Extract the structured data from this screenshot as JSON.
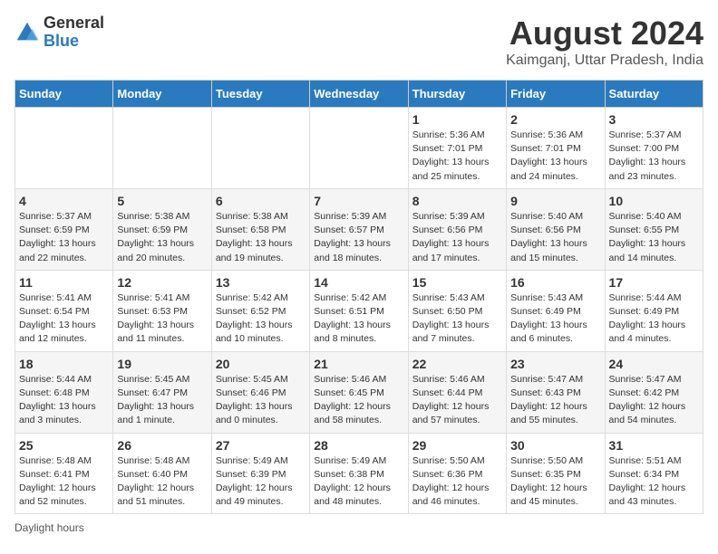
{
  "logo": {
    "general": "General",
    "blue": "Blue"
  },
  "title": "August 2024",
  "location": "Kaimganj, Uttar Pradesh, India",
  "days_of_week": [
    "Sunday",
    "Monday",
    "Tuesday",
    "Wednesday",
    "Thursday",
    "Friday",
    "Saturday"
  ],
  "footer": {
    "daylight_label": "Daylight hours"
  },
  "weeks": [
    [
      {
        "num": "",
        "info": ""
      },
      {
        "num": "",
        "info": ""
      },
      {
        "num": "",
        "info": ""
      },
      {
        "num": "",
        "info": ""
      },
      {
        "num": "1",
        "info": "Sunrise: 5:36 AM\nSunset: 7:01 PM\nDaylight: 13 hours\nand 25 minutes."
      },
      {
        "num": "2",
        "info": "Sunrise: 5:36 AM\nSunset: 7:01 PM\nDaylight: 13 hours\nand 24 minutes."
      },
      {
        "num": "3",
        "info": "Sunrise: 5:37 AM\nSunset: 7:00 PM\nDaylight: 13 hours\nand 23 minutes."
      }
    ],
    [
      {
        "num": "4",
        "info": "Sunrise: 5:37 AM\nSunset: 6:59 PM\nDaylight: 13 hours\nand 22 minutes."
      },
      {
        "num": "5",
        "info": "Sunrise: 5:38 AM\nSunset: 6:59 PM\nDaylight: 13 hours\nand 20 minutes."
      },
      {
        "num": "6",
        "info": "Sunrise: 5:38 AM\nSunset: 6:58 PM\nDaylight: 13 hours\nand 19 minutes."
      },
      {
        "num": "7",
        "info": "Sunrise: 5:39 AM\nSunset: 6:57 PM\nDaylight: 13 hours\nand 18 minutes."
      },
      {
        "num": "8",
        "info": "Sunrise: 5:39 AM\nSunset: 6:56 PM\nDaylight: 13 hours\nand 17 minutes."
      },
      {
        "num": "9",
        "info": "Sunrise: 5:40 AM\nSunset: 6:56 PM\nDaylight: 13 hours\nand 15 minutes."
      },
      {
        "num": "10",
        "info": "Sunrise: 5:40 AM\nSunset: 6:55 PM\nDaylight: 13 hours\nand 14 minutes."
      }
    ],
    [
      {
        "num": "11",
        "info": "Sunrise: 5:41 AM\nSunset: 6:54 PM\nDaylight: 13 hours\nand 12 minutes."
      },
      {
        "num": "12",
        "info": "Sunrise: 5:41 AM\nSunset: 6:53 PM\nDaylight: 13 hours\nand 11 minutes."
      },
      {
        "num": "13",
        "info": "Sunrise: 5:42 AM\nSunset: 6:52 PM\nDaylight: 13 hours\nand 10 minutes."
      },
      {
        "num": "14",
        "info": "Sunrise: 5:42 AM\nSunset: 6:51 PM\nDaylight: 13 hours\nand 8 minutes."
      },
      {
        "num": "15",
        "info": "Sunrise: 5:43 AM\nSunset: 6:50 PM\nDaylight: 13 hours\nand 7 minutes."
      },
      {
        "num": "16",
        "info": "Sunrise: 5:43 AM\nSunset: 6:49 PM\nDaylight: 13 hours\nand 6 minutes."
      },
      {
        "num": "17",
        "info": "Sunrise: 5:44 AM\nSunset: 6:49 PM\nDaylight: 13 hours\nand 4 minutes."
      }
    ],
    [
      {
        "num": "18",
        "info": "Sunrise: 5:44 AM\nSunset: 6:48 PM\nDaylight: 13 hours\nand 3 minutes."
      },
      {
        "num": "19",
        "info": "Sunrise: 5:45 AM\nSunset: 6:47 PM\nDaylight: 13 hours\nand 1 minute."
      },
      {
        "num": "20",
        "info": "Sunrise: 5:45 AM\nSunset: 6:46 PM\nDaylight: 13 hours\nand 0 minutes."
      },
      {
        "num": "21",
        "info": "Sunrise: 5:46 AM\nSunset: 6:45 PM\nDaylight: 12 hours\nand 58 minutes."
      },
      {
        "num": "22",
        "info": "Sunrise: 5:46 AM\nSunset: 6:44 PM\nDaylight: 12 hours\nand 57 minutes."
      },
      {
        "num": "23",
        "info": "Sunrise: 5:47 AM\nSunset: 6:43 PM\nDaylight: 12 hours\nand 55 minutes."
      },
      {
        "num": "24",
        "info": "Sunrise: 5:47 AM\nSunset: 6:42 PM\nDaylight: 12 hours\nand 54 minutes."
      }
    ],
    [
      {
        "num": "25",
        "info": "Sunrise: 5:48 AM\nSunset: 6:41 PM\nDaylight: 12 hours\nand 52 minutes."
      },
      {
        "num": "26",
        "info": "Sunrise: 5:48 AM\nSunset: 6:40 PM\nDaylight: 12 hours\nand 51 minutes."
      },
      {
        "num": "27",
        "info": "Sunrise: 5:49 AM\nSunset: 6:39 PM\nDaylight: 12 hours\nand 49 minutes."
      },
      {
        "num": "28",
        "info": "Sunrise: 5:49 AM\nSunset: 6:38 PM\nDaylight: 12 hours\nand 48 minutes."
      },
      {
        "num": "29",
        "info": "Sunrise: 5:50 AM\nSunset: 6:36 PM\nDaylight: 12 hours\nand 46 minutes."
      },
      {
        "num": "30",
        "info": "Sunrise: 5:50 AM\nSunset: 6:35 PM\nDaylight: 12 hours\nand 45 minutes."
      },
      {
        "num": "31",
        "info": "Sunrise: 5:51 AM\nSunset: 6:34 PM\nDaylight: 12 hours\nand 43 minutes."
      }
    ]
  ]
}
